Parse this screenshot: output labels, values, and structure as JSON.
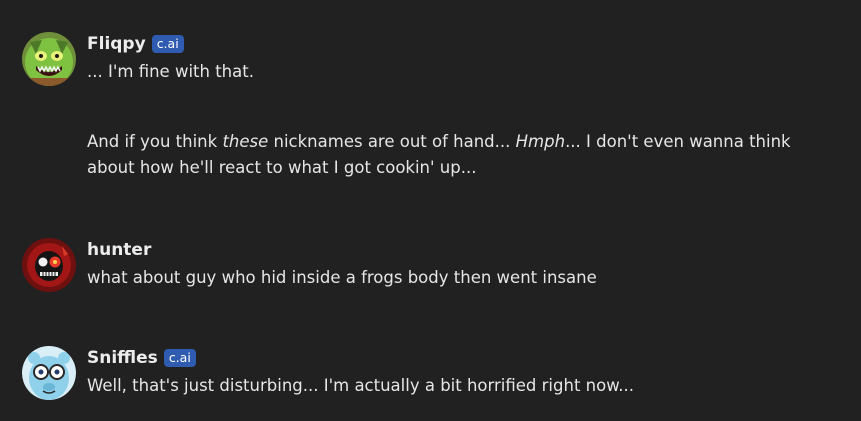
{
  "messages": [
    {
      "author": "Fliqpy",
      "badge": "c.ai",
      "avatar_icon": "green-bear-avatar-icon",
      "paragraphs": [
        {
          "p1": "... I'm fine with that."
        },
        {
          "t1": "And if you think ",
          "t2": "these",
          "t3": " nicknames are out of hand... ",
          "t4": "Hmph",
          "t5": "... I don't even wanna think about how he'll react to what I got cookin' up..."
        }
      ]
    },
    {
      "author": "hunter",
      "avatar_icon": "red-skull-avatar-icon",
      "text": "what about guy who hid inside a frogs body then went insane"
    },
    {
      "author": "Sniffles",
      "badge": "c.ai",
      "avatar_icon": "blue-anteater-avatar-icon",
      "text": "Well, that's just disturbing... I'm actually a bit horrified right now..."
    }
  ],
  "colors": {
    "background": "#212121",
    "badge": "#2f5bb1",
    "text": "#e6e6e6"
  }
}
